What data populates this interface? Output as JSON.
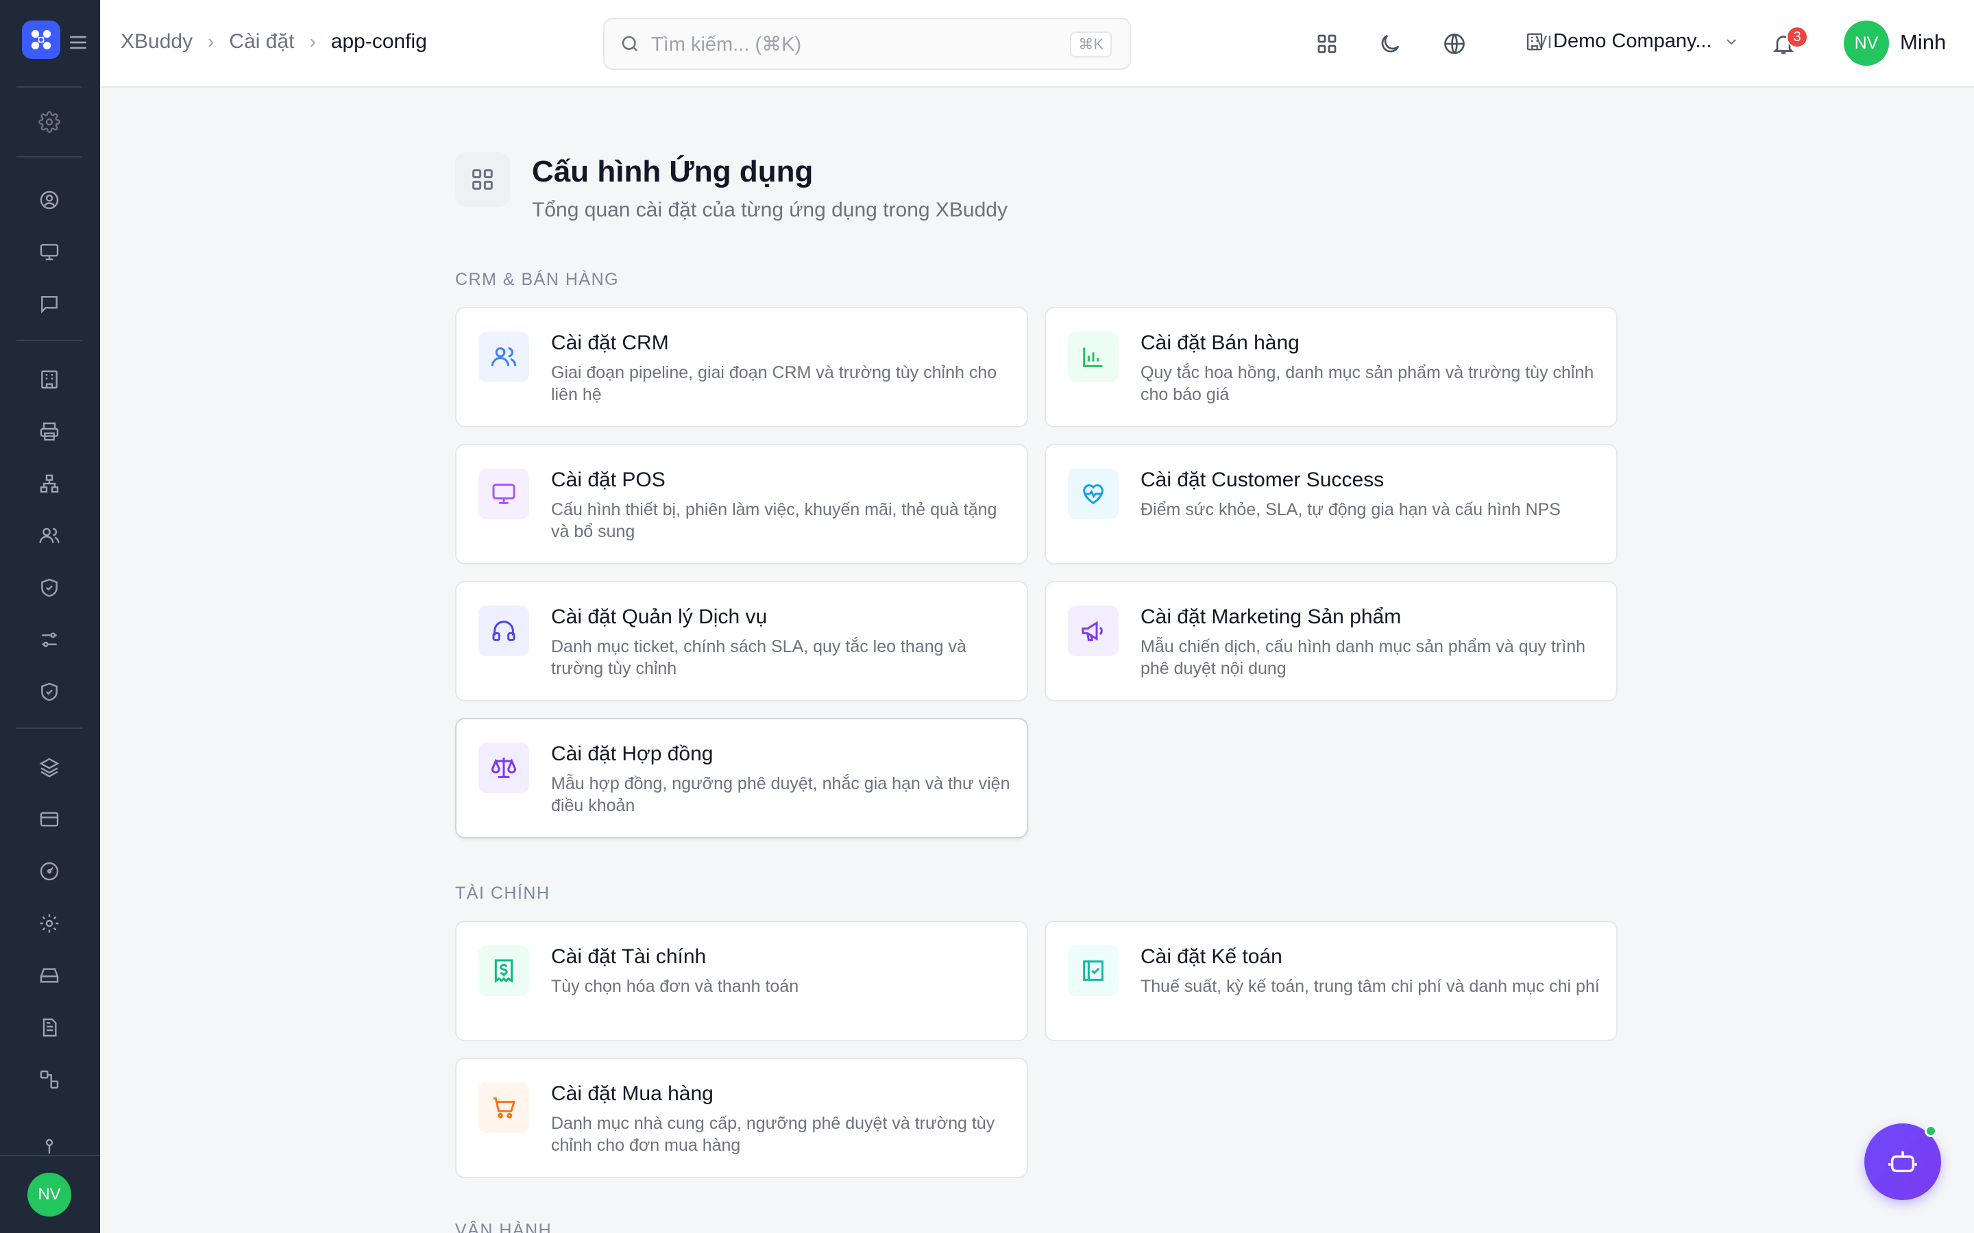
{
  "header": {
    "breadcrumb": [
      "XBuddy",
      "Cài đặt",
      "app-config"
    ],
    "search_placeholder": "Tìm kiếm... (⌘K)",
    "search_shortcut": "⌘K",
    "language": "VI",
    "company": "Demo Company...",
    "notification_count": "3",
    "avatar_initials": "NV",
    "user_name": "Minh"
  },
  "sidebar": {
    "avatar_initials": "NV",
    "icons": [
      "settings-icon",
      "user-circle-icon",
      "monitor-icon",
      "chat-icon",
      "building-icon",
      "printer-icon",
      "org-chart-icon",
      "users-icon",
      "shield-check-icon",
      "sliders-icon",
      "shield-check-icon",
      "layers-icon",
      "credit-card-icon",
      "gauge-icon",
      "settings-icon",
      "hard-drive-icon",
      "document-icon",
      "workflow-icon",
      "pin-icon"
    ]
  },
  "page": {
    "title": "Cấu hình Ứng dụng",
    "subtitle": "Tổng quan cài đặt của từng ứng dụng trong XBuddy"
  },
  "sections": [
    {
      "label": "CRM & BÁN HÀNG",
      "cards": [
        {
          "title": "Cài đặt CRM",
          "desc": "Giai đoạn pipeline, giai đoạn CRM và trường tùy chỉnh cho liên hệ",
          "icon": "users-icon",
          "color": "#3b82f6",
          "bg": "#eef4ff"
        },
        {
          "title": "Cài đặt Bán hàng",
          "desc": "Quy tắc hoa hồng, danh mục sản phẩm và trường tùy chỉnh cho báo giá",
          "icon": "bar-chart-icon",
          "color": "#22c55e",
          "bg": "#ecfdf3"
        },
        {
          "title": "Cài đặt POS",
          "desc": "Cấu hình thiết bị, phiên làm việc, khuyến mãi, thẻ quà tặng và bổ sung",
          "icon": "monitor-icon",
          "color": "#a855f7",
          "bg": "#f6efff"
        },
        {
          "title": "Cài đặt Customer Success",
          "desc": "Điểm sức khỏe, SLA, tự động gia hạn và cấu hình NPS",
          "icon": "heart-pulse-icon",
          "color": "#0ea5e9",
          "bg": "#ecf8ff"
        },
        {
          "title": "Cài đặt Quản lý Dịch vụ",
          "desc": "Danh mục ticket, chính sách SLA, quy tắc leo thang và trường tùy chỉnh",
          "icon": "headphones-icon",
          "color": "#4f46e5",
          "bg": "#eef0ff"
        },
        {
          "title": "Cài đặt Marketing Sản phẩm",
          "desc": "Mẫu chiến dịch, cấu hình danh mục sản phẩm và quy trình phê duyệt nội dung",
          "icon": "megaphone-icon",
          "color": "#7c3aed",
          "bg": "#f3eeff"
        },
        {
          "title": "Cài đặt Hợp đồng",
          "desc": "Mẫu hợp đồng, ngưỡng phê duyệt, nhắc gia hạn và thư viện điều khoản",
          "icon": "scale-icon",
          "color": "#7c3aed",
          "bg": "#f3eeff"
        }
      ]
    },
    {
      "label": "TÀI CHÍNH",
      "cards": [
        {
          "title": "Cài đặt Tài chính",
          "desc": "Tùy chọn hóa đơn và thanh toán",
          "icon": "receipt-icon",
          "color": "#10b981",
          "bg": "#ecfdf5"
        },
        {
          "title": "Cài đặt Kế toán",
          "desc": "Thuế suất, kỳ kế toán, trung tâm chi phí và danh mục chi phí",
          "icon": "ledger-check-icon",
          "color": "#14b8a6",
          "bg": "#ecfdfa"
        },
        {
          "title": "Cài đặt Mua hàng",
          "desc": "Danh mục nhà cung cấp, ngưỡng phê duyệt và trường tùy chỉnh cho đơn mua hàng",
          "icon": "cart-icon",
          "color": "#f97316",
          "bg": "#fff5ec"
        }
      ]
    },
    {
      "label": "VẬN HÀNH",
      "cards": []
    }
  ]
}
